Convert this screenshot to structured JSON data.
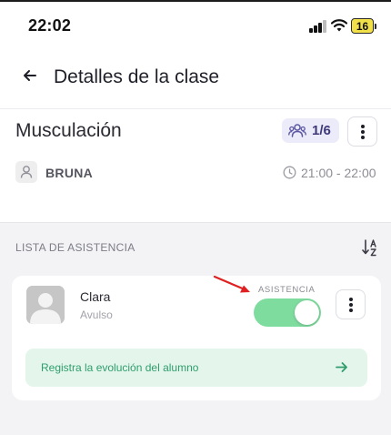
{
  "status_bar": {
    "time": "22:02",
    "battery": "16"
  },
  "header": {
    "title": "Detalles de la clase"
  },
  "class": {
    "name": "Musculación",
    "capacity": "1/6",
    "instructor": "BRUNA",
    "time": "21:00 - 22:00"
  },
  "attendance": {
    "section_title": "LISTA DE ASISTENCIA",
    "students": [
      {
        "name": "Clara",
        "plan": "Avulso",
        "attendance_label": "ASISTENCIA",
        "attended": true,
        "evolution_label": "Registra la evolución del alumno"
      }
    ]
  },
  "colors": {
    "toggle_on": "#7fdc9f",
    "accent_green": "#2f9e6b",
    "badge_bg": "#ecebfa",
    "annotation_arrow": "#e02020"
  }
}
